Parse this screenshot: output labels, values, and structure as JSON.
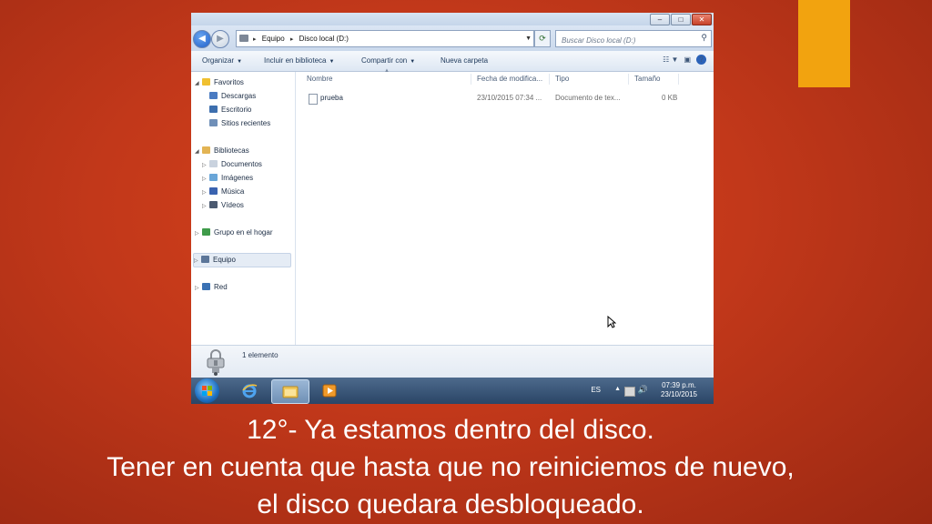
{
  "colors": {
    "slide_bg": "#c9401a",
    "accent": "#f2a30f"
  },
  "explorer": {
    "address": {
      "crumbs": [
        "Equipo",
        "Disco local (D:)"
      ]
    },
    "search": {
      "placeholder": "Buscar Disco local (D:)"
    },
    "toolbar": {
      "organizar": "Organizar",
      "incluir": "Incluir en biblioteca",
      "compartir": "Compartir con",
      "nueva_carpeta": "Nueva carpeta"
    },
    "nav": {
      "favoritos": "Favoritos",
      "descargas": "Descargas",
      "escritorio": "Escritorio",
      "sitios": "Sitios recientes",
      "bibliotecas": "Bibliotecas",
      "documentos": "Documentos",
      "imagenes": "Imágenes",
      "musica": "Música",
      "videos": "Vídeos",
      "grupo": "Grupo en el hogar",
      "equipo": "Equipo",
      "red": "Red"
    },
    "columns": {
      "nombre": "Nombre",
      "fecha": "Fecha de modifica...",
      "tipo": "Tipo",
      "tamano": "Tamaño"
    },
    "files": [
      {
        "name": "prueba",
        "date": "23/10/2015 07:34 ...",
        "type": "Documento de tex...",
        "size": "0 KB"
      }
    ],
    "status": "1 elemento"
  },
  "taskbar": {
    "lang": "ES",
    "time": "07:39 p.m.",
    "date": "23/10/2015"
  },
  "caption": {
    "line1": "12°- Ya estamos dentro del disco.",
    "line2": "Tener en cuenta que hasta que no reiniciemos de nuevo,",
    "line3": "el disco quedara desbloqueado."
  }
}
